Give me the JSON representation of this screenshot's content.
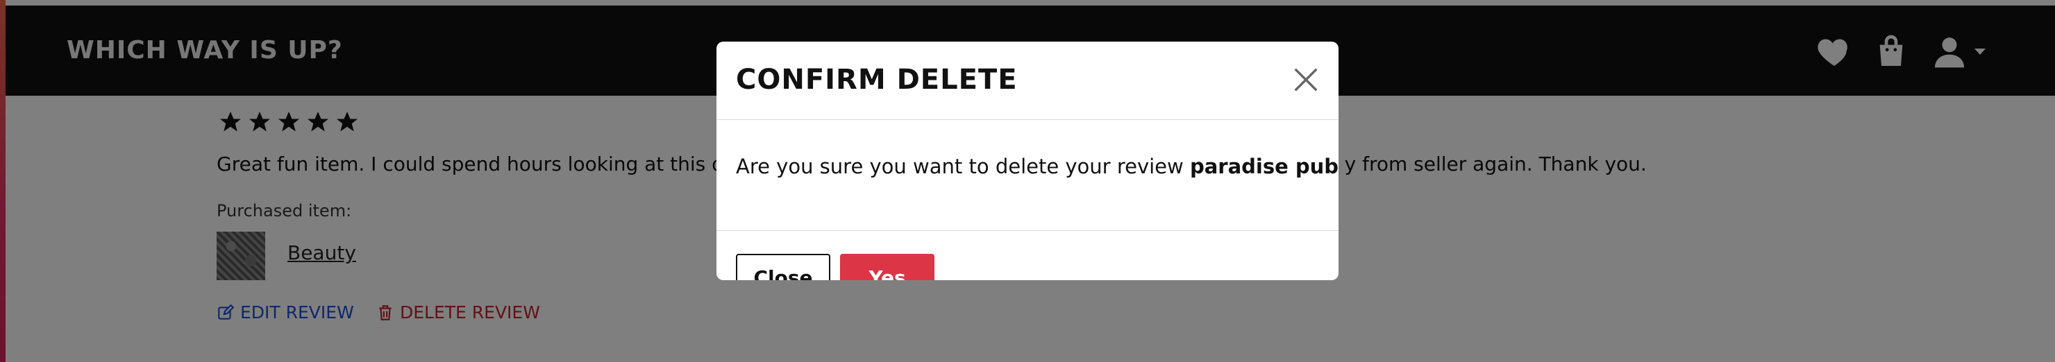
{
  "navbar": {
    "brand": "WHICH WAY IS UP?",
    "icons": [
      "heart-icon",
      "shopping-bag-icon",
      "user-icon",
      "caret-down-icon"
    ]
  },
  "review": {
    "rating": 5,
    "text": "Great fun item. I could spend hours looking at this dooc",
    "text_tail": "y from seller again. Thank you.",
    "purchased_label": "Purchased item:",
    "item_name": "Beauty",
    "edit_label": "EDIT REVIEW",
    "delete_label": "DELETE REVIEW"
  },
  "modal": {
    "title": "CONFIRM DELETE",
    "message_prefix": "Are you sure you want to delete your review ",
    "review_name": "paradise pub",
    "message_suffix": "?",
    "close_label": "Close",
    "yes_label": "Yes"
  },
  "colors": {
    "navbar": "#111111",
    "danger": "#dc3545",
    "link": "#1a4fd8"
  }
}
